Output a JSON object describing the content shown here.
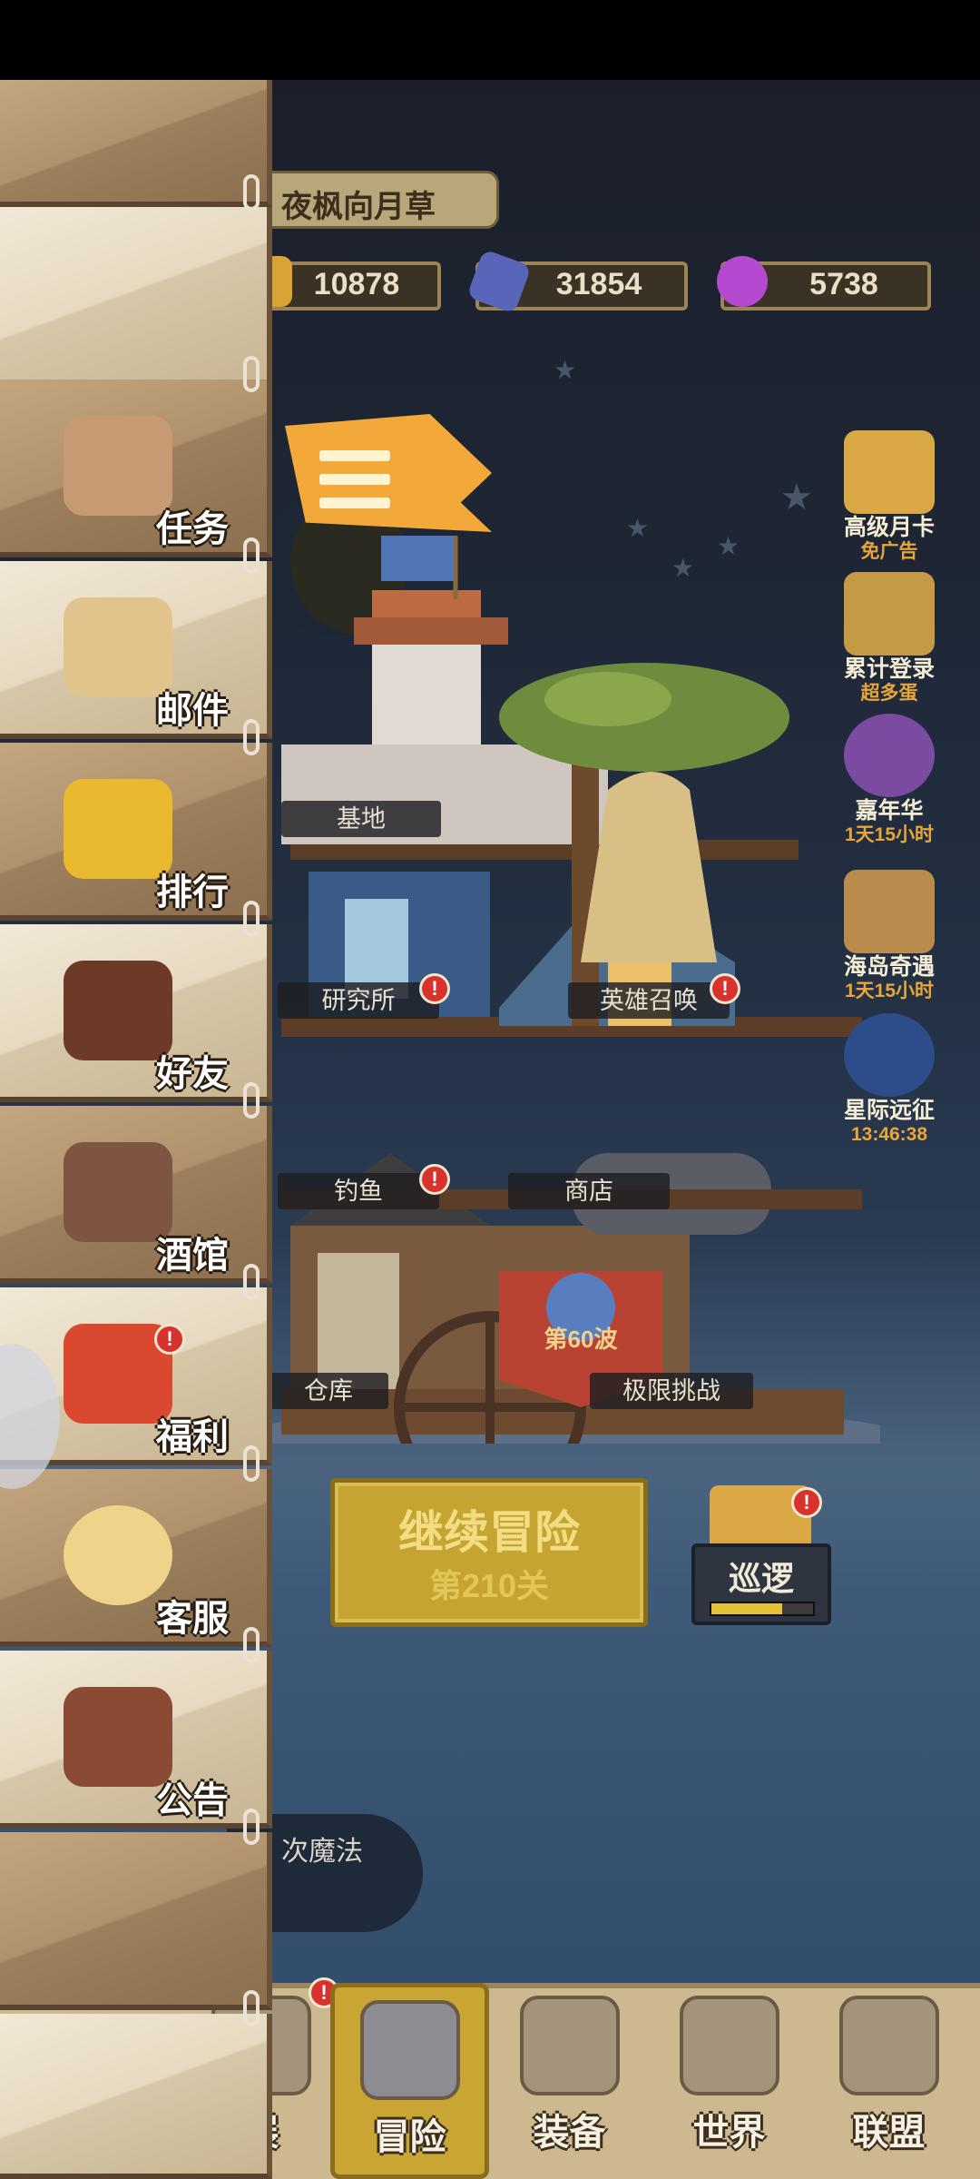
{
  "player": {
    "name": "夜枫向月草",
    "gold": "10878",
    "gems": "31854",
    "crystals": "5738"
  },
  "events": [
    {
      "title": "高级月卡",
      "sub": "免广告",
      "icon": "monthly-card-icon"
    },
    {
      "title": "累计登录",
      "sub": "超多蛋",
      "icon": "login-egg-icon"
    },
    {
      "title": "嘉年华",
      "sub": "1天15小时",
      "icon": "carnival-icon"
    },
    {
      "title": "海岛奇遇",
      "sub": "1天15小时",
      "icon": "island-adventure-icon"
    },
    {
      "title": "星际远征",
      "sub": "13:46:38",
      "icon": "rocket-icon"
    }
  ],
  "buildings": {
    "base": "基地",
    "research": "研究所",
    "summon": "英雄召唤",
    "fishing": "钓鱼",
    "shop": "商店",
    "warehouse": "仓库",
    "challenge": "极限挑战",
    "wave_banner": "第60波"
  },
  "badges": {
    "alert": "!"
  },
  "continue": {
    "title": "继续冒险",
    "level": "第210关"
  },
  "patrol": {
    "label": "巡逻",
    "progress_fraction": 0.7
  },
  "magic_pill": {
    "text": "次魔法"
  },
  "side_menu": [
    {
      "label": "任务",
      "icon": "scroll-icon"
    },
    {
      "label": "邮件",
      "icon": "letter-icon"
    },
    {
      "label": "排行",
      "icon": "trophy-icon"
    },
    {
      "label": "好友",
      "icon": "friends-icon"
    },
    {
      "label": "酒馆",
      "icon": "beer-mug-icon"
    },
    {
      "label": "福利",
      "icon": "gift-icon"
    },
    {
      "label": "客服",
      "icon": "headset-icon"
    },
    {
      "label": "公告",
      "icon": "notice-board-icon"
    }
  ],
  "bottom_nav": [
    {
      "label": "展",
      "icon": "home-icon"
    },
    {
      "label": "冒险",
      "icon": "crossed-swords-icon"
    },
    {
      "label": "装备",
      "icon": "anvil-icon"
    },
    {
      "label": "世界",
      "icon": "map-icon"
    },
    {
      "label": "联盟",
      "icon": "shield-icon"
    }
  ],
  "colors": {
    "accent_gold": "#c6a432",
    "alert_red": "#d7322b",
    "timer_orange": "#e8a53a"
  }
}
